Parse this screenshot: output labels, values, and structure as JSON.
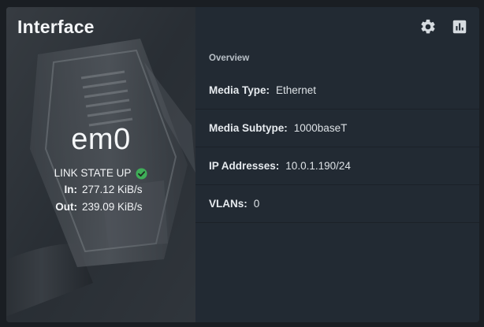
{
  "widget": {
    "title": "Interface"
  },
  "interface": {
    "name": "em0",
    "link_state": "LINK STATE UP",
    "in_label": "In:",
    "in_value": "277.12 KiB/s",
    "out_label": "Out:",
    "out_value": "239.09 KiB/s"
  },
  "toolbar": {
    "settings_icon": "gear-icon",
    "stats_icon": "bar-chart-icon"
  },
  "overview": {
    "label": "Overview",
    "rows": [
      {
        "key": "Media Type:",
        "value": "Ethernet"
      },
      {
        "key": "Media Subtype:",
        "value": "1000baseT"
      },
      {
        "key": "IP Addresses:",
        "value": "10.0.1.190/24"
      },
      {
        "key": "VLANs:",
        "value": "0"
      }
    ]
  },
  "colors": {
    "status_ok": "#3fae58",
    "panel_bg": "#222a33",
    "page_bg": "#1a1e23"
  }
}
